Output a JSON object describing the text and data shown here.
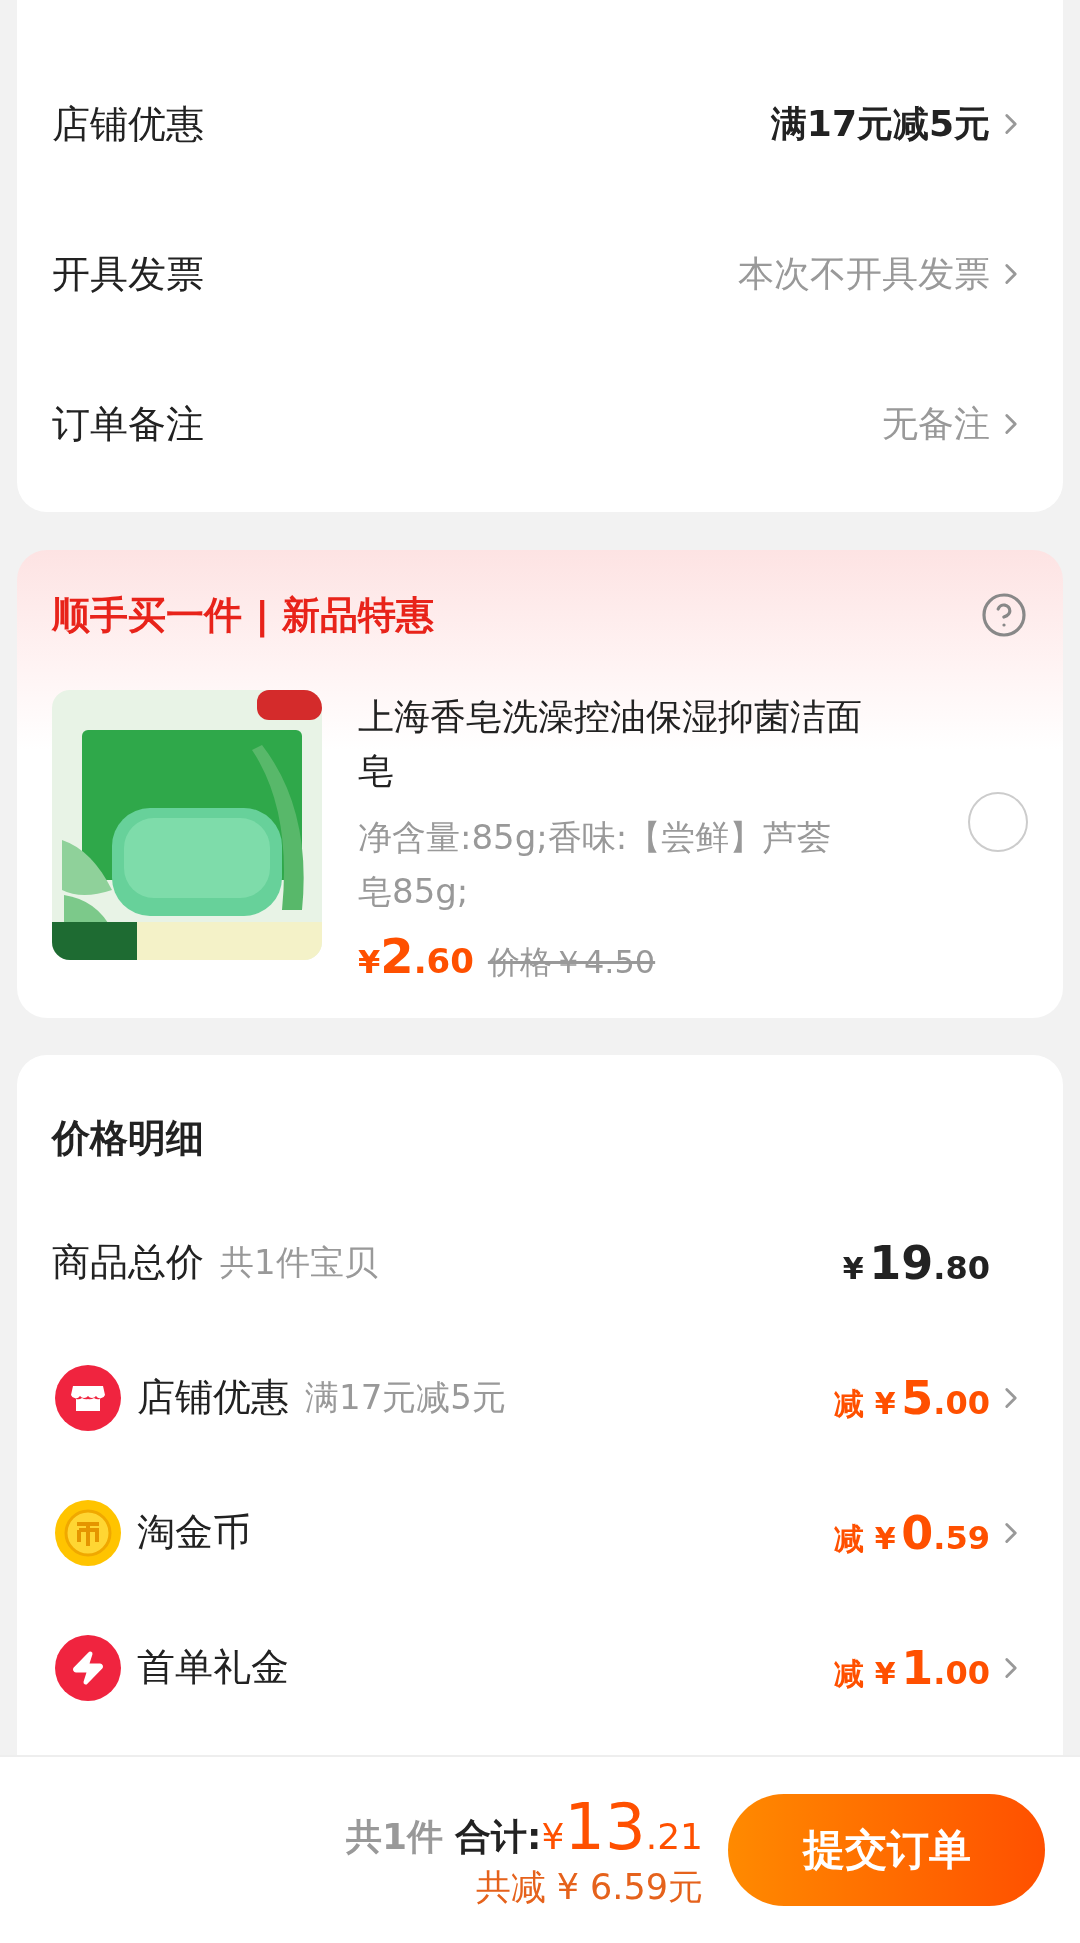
{
  "order_options": [
    {
      "label": "店铺优惠",
      "value": "满17元减5元",
      "emphasis": true
    },
    {
      "label": "开具发票",
      "value": "本次不开具发票",
      "emphasis": false
    },
    {
      "label": "订单备注",
      "value": "无备注",
      "emphasis": false
    }
  ],
  "addon": {
    "title": "顺手买一件 | 新品特惠",
    "product": {
      "kind": "picture",
      "title_lines": [
        "上海香皂洗澡控油保湿抑菌洁面",
        "皂"
      ],
      "spec_lines": [
        "净含量:85g;香味:【尝鲜】芦荟",
        "皂85g;"
      ],
      "currency": "¥",
      "price_int": "2",
      "price_dec": ".60",
      "original_price": "价格￥4.50",
      "selected": false
    }
  },
  "price_detail": {
    "title": "价格明细",
    "rows": [
      {
        "kind": "total",
        "label": "商品总价",
        "note": "共1件宝贝",
        "currency": "¥",
        "int": "19",
        "dec": ".80"
      },
      {
        "kind": "shop",
        "label": "店铺优惠",
        "note": "满17元减5元",
        "prefix": "减",
        "currency": "¥",
        "int": "5",
        "dec": ".00"
      },
      {
        "kind": "coin",
        "label": "淘金币",
        "prefix": "减",
        "currency": "¥",
        "int": "0",
        "dec": ".59"
      },
      {
        "kind": "bolt",
        "label": "首单礼金",
        "prefix": "减",
        "currency": "¥",
        "int": "1",
        "dec": ".00"
      }
    ]
  },
  "footer": {
    "count": "共1件",
    "total_label": "合计:",
    "currency": "¥",
    "total_int": "13",
    "total_dec": ".21",
    "saved": "共减 ¥ 6.59元",
    "submit": "提交订单"
  }
}
